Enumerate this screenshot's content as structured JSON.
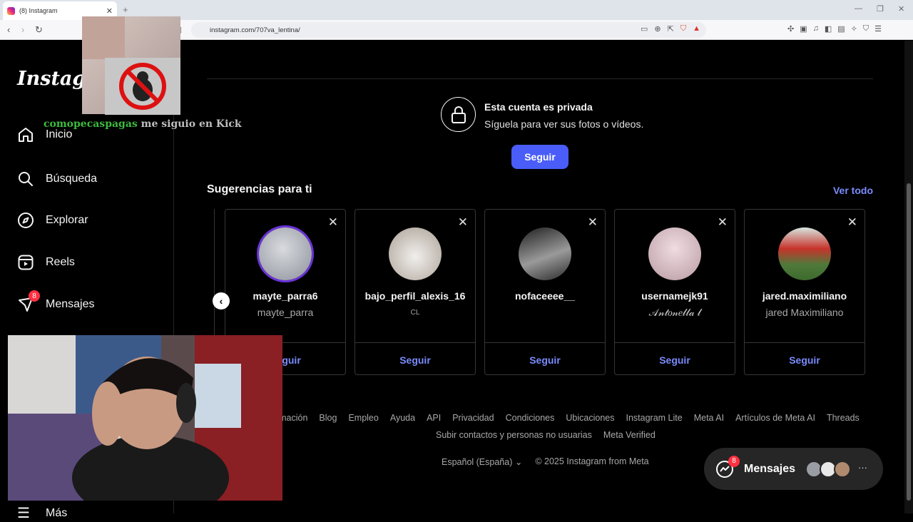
{
  "browser": {
    "tab_title": "(8) Instagram",
    "url": "instagram.com/707va_lentina/"
  },
  "sidebar": {
    "logo": "Instagram",
    "items": [
      {
        "label": "Inicio",
        "icon": "home-icon"
      },
      {
        "label": "Búsqueda",
        "icon": "search-icon"
      },
      {
        "label": "Explorar",
        "icon": "compass-icon"
      },
      {
        "label": "Reels",
        "icon": "reels-icon"
      },
      {
        "label": "Mensajes",
        "icon": "messages-icon",
        "badge": "8"
      }
    ],
    "more_label": "Más"
  },
  "profile": {
    "private_title": "Esta cuenta es privada",
    "private_subtitle": "Síguela para ver sus fotos o vídeos.",
    "follow_label": "Seguir"
  },
  "suggestions": {
    "title": "Sugerencias para ti",
    "see_all": "Ver todo",
    "cards": [
      {
        "username": "mayte_parra6",
        "name": "mayte_parra",
        "follow": "Seguir",
        "avatar_color": "#b9bcc4"
      },
      {
        "username": "bajo_perfil_alexis_16",
        "name": "CL",
        "follow": "Seguir",
        "avatar_color": "#d8d4d0"
      },
      {
        "username": "nofaceeee__",
        "name": "",
        "follow": "Seguir",
        "avatar_color": "#3a3a3a"
      },
      {
        "username": "usernamejk91",
        "name": "𝒜𝓃𝓉𝑜𝓃𝑒𝓁𝓁𝒶 𝓁",
        "follow": "Seguir",
        "avatar_color": "#e6ccd4"
      },
      {
        "username": "jared.maximiliano",
        "name": "jared Maximiliano",
        "follow": "Seguir",
        "avatar_color": "#5f8a4a"
      }
    ],
    "partial_follow": "guir"
  },
  "footer": {
    "links": [
      "ormación",
      "Blog",
      "Empleo",
      "Ayuda",
      "API",
      "Privacidad",
      "Condiciones",
      "Ubicaciones",
      "Instagram Lite",
      "Meta AI",
      "Artículos de Meta AI",
      "Threads"
    ],
    "links2": [
      "Subir contactos y personas no usuarias",
      "Meta Verified"
    ],
    "language": "Español (España)",
    "copyright": "© 2025 Instagram from Meta"
  },
  "messages_pill": {
    "label": "Mensajes",
    "badge": "8"
  },
  "stream_overlay": {
    "alert_user": "comopecaspagas",
    "alert_message": "me siguio en Kick"
  }
}
